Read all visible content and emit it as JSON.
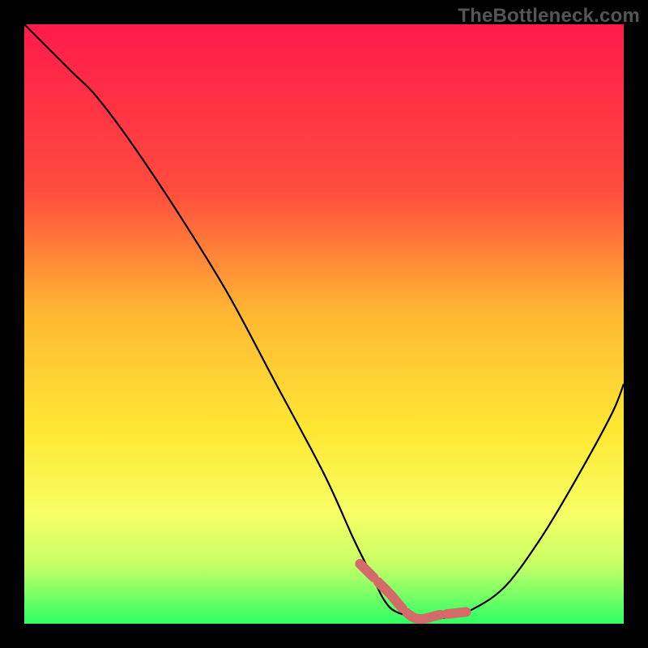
{
  "watermark": "TheBottleneck.com",
  "chart_data": {
    "type": "line",
    "title": "",
    "xlabel": "",
    "ylabel": "",
    "xlim": [
      0,
      100
    ],
    "ylim": [
      0,
      100
    ],
    "gradient_stops": [
      {
        "offset": 0,
        "color": "#ff1a4b"
      },
      {
        "offset": 28,
        "color": "#ff4d3d"
      },
      {
        "offset": 48,
        "color": "#ffb733"
      },
      {
        "offset": 68,
        "color": "#ffe833"
      },
      {
        "offset": 82,
        "color": "#f6ff66"
      },
      {
        "offset": 90,
        "color": "#c8ff66"
      },
      {
        "offset": 95,
        "color": "#7dff66"
      },
      {
        "offset": 100,
        "color": "#2dff66"
      }
    ],
    "curve": {
      "x": [
        0,
        4,
        8,
        12,
        18,
        26,
        34,
        42,
        50,
        55,
        58,
        60,
        62,
        66,
        70,
        74,
        80,
        86,
        92,
        98,
        100
      ],
      "y": [
        100,
        96,
        92,
        88,
        80,
        68,
        55,
        40,
        25,
        14,
        8,
        4,
        2,
        1,
        1,
        2,
        6,
        14,
        24,
        35,
        40
      ]
    },
    "optimal_segment": {
      "x_start": 56,
      "x_end": 74,
      "y_at_start": 10,
      "y_at_end": 2,
      "y_floor": 1
    },
    "segment_color": "#d46a6a",
    "segment_stroke_width": 12
  }
}
